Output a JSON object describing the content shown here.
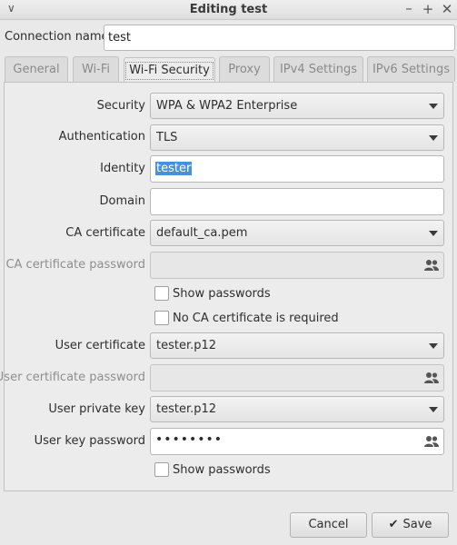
{
  "window": {
    "title": "Editing test",
    "controls": {
      "menu": "∨",
      "minimize": "–",
      "maximize": "+",
      "close": "✕"
    }
  },
  "connection_name": {
    "label": "Connection name",
    "value": "test"
  },
  "tabs": [
    {
      "label": "General"
    },
    {
      "label": "Wi-Fi"
    },
    {
      "label": "Wi-Fi Security",
      "active": true
    },
    {
      "label": "Proxy"
    },
    {
      "label": "IPv4 Settings"
    },
    {
      "label": "IPv6 Settings"
    }
  ],
  "security": {
    "security": {
      "label": "Security",
      "value": "WPA & WPA2 Enterprise"
    },
    "authentication": {
      "label": "Authentication",
      "value": "TLS"
    },
    "identity": {
      "label": "Identity",
      "value": "tester"
    },
    "domain": {
      "label": "Domain",
      "value": ""
    },
    "ca_certificate": {
      "label": "CA certificate",
      "value": "default_ca.pem"
    },
    "ca_certificate_password": {
      "label": "CA certificate password",
      "value": ""
    },
    "show_passwords_1": {
      "label": "Show passwords",
      "checked": false
    },
    "no_ca_required": {
      "label": "No CA certificate is required",
      "checked": false
    },
    "user_certificate": {
      "label": "User certificate",
      "value": "tester.p12"
    },
    "user_certificate_password": {
      "label": "User certificate password",
      "value": ""
    },
    "user_private_key": {
      "label": "User private key",
      "value": "tester.p12"
    },
    "user_key_password": {
      "label": "User key password",
      "masked": "••••••••"
    },
    "show_passwords_2": {
      "label": "Show passwords",
      "checked": false
    }
  },
  "buttons": {
    "cancel": "Cancel",
    "save": "Save",
    "save_icon": "✔"
  }
}
